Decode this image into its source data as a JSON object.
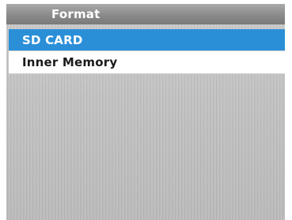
{
  "title": "Format",
  "menu": {
    "items": [
      {
        "label": "SD CARD",
        "selected": true
      },
      {
        "label": "Inner Memory",
        "selected": false
      }
    ]
  },
  "colors": {
    "highlight": "#2b8fd8",
    "title_bar": "#8a8a8a",
    "background": "#c2c2c2"
  }
}
